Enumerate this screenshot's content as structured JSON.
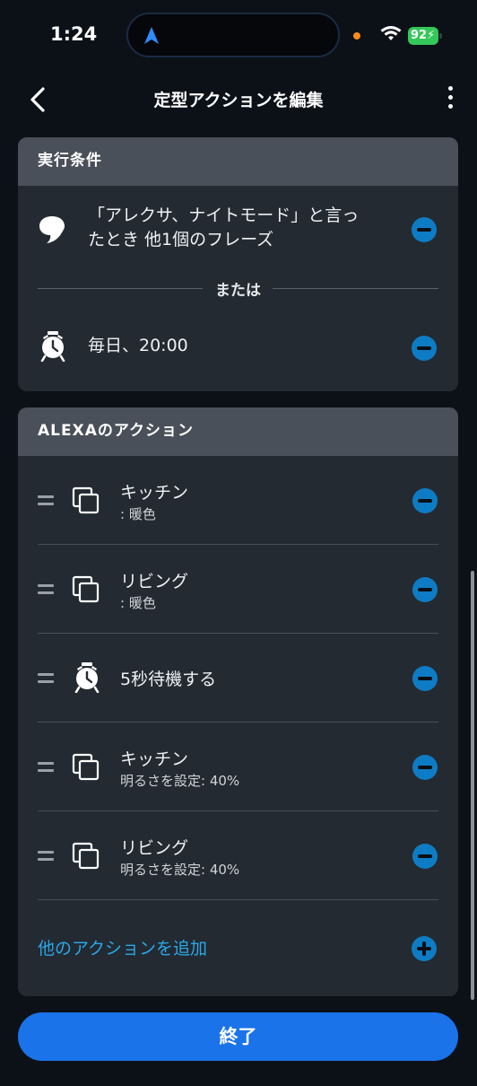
{
  "status_bar": {
    "time": "1:24",
    "battery": "92"
  },
  "nav": {
    "title": "定型アクションを編集"
  },
  "trigger_card": {
    "header": "実行条件",
    "triggers": [
      {
        "icon": "speech-bubble-icon",
        "line1": "「アレクサ、ナイトモード」と言っ",
        "line2": "たとき 他1個のフレーズ"
      },
      {
        "icon": "alarm-clock-icon",
        "text": "毎日、20:00"
      }
    ],
    "separator": "または"
  },
  "actions_card": {
    "header": "ALEXAのアクション",
    "actions": [
      {
        "icon": "device-group-icon",
        "title": "キッチン",
        "subtitle": ": 暖色"
      },
      {
        "icon": "device-group-icon",
        "title": "リビング",
        "subtitle": ": 暖色"
      },
      {
        "icon": "alarm-clock-icon",
        "title": "5秒待機する"
      },
      {
        "icon": "device-group-icon",
        "title": "キッチン",
        "subtitle": "明るさを設定: 40%"
      },
      {
        "icon": "device-group-icon",
        "title": "リビング",
        "subtitle": "明るさを設定: 40%"
      }
    ],
    "add_action_label": "他のアクションを追加"
  },
  "done_button": "終了",
  "colors": {
    "accent": "#0e7cc4",
    "link": "#2aa7e6",
    "primary_button": "#1a73e8",
    "background": "#0c1118",
    "card": "#232a32"
  }
}
